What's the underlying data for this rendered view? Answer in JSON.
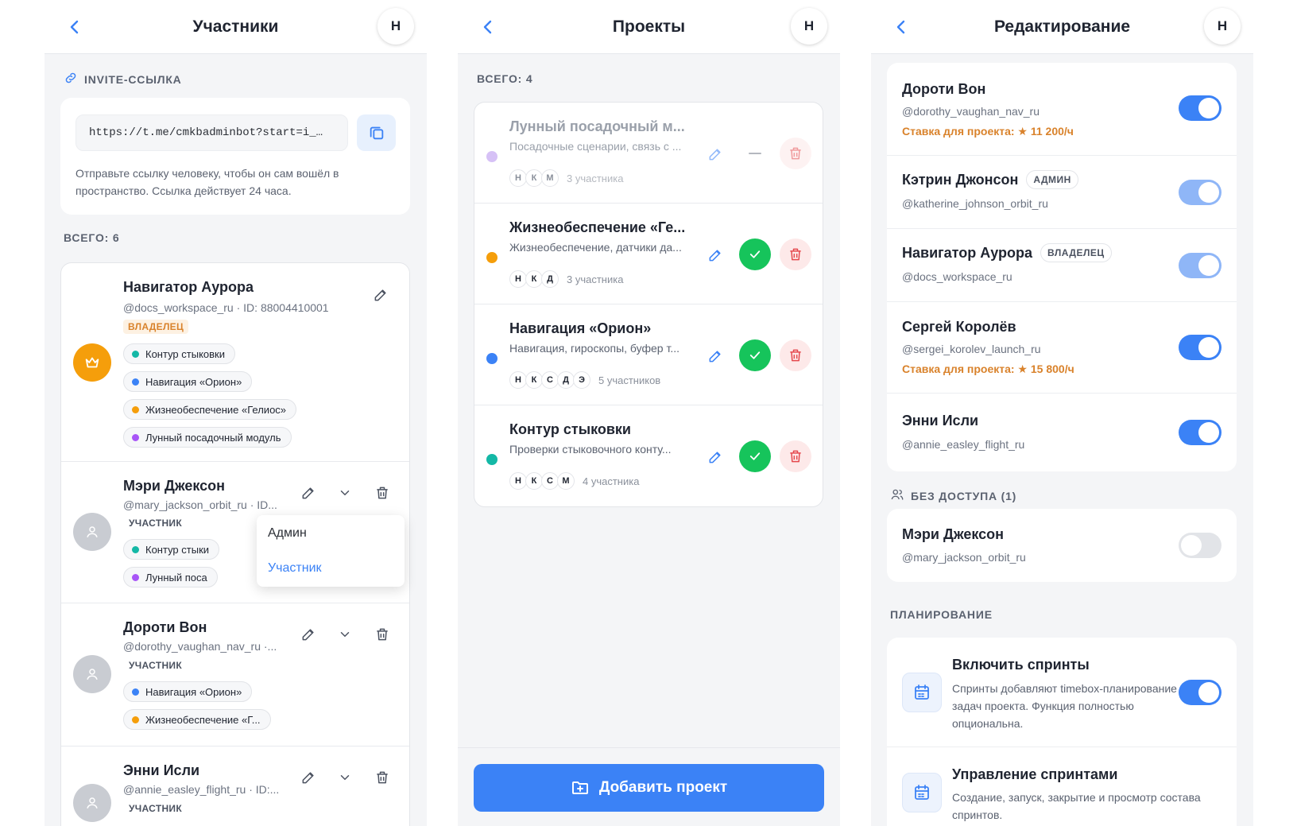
{
  "colors": {
    "accent": "#3b82f6",
    "success": "#16c45b",
    "danger": "#e5484d",
    "warning": "#d9822b",
    "teal": "#14b8a6",
    "blue": "#3b82f6",
    "orange": "#f59e0b",
    "purple": "#a855f7"
  },
  "header_avatar": "Н",
  "participants": {
    "title": "Участники",
    "invite_label": "INVITE-ССЫЛКА",
    "invite_link": "https://t.me/cmkbadminbot?start=i_…",
    "invite_note": "Отправьте ссылку человеку, чтобы он сам вошёл в пространство. Ссылка действует 24 часа.",
    "total": "ВСЕГО: 6",
    "members": [
      {
        "name": "Навигатор Аурора",
        "handle": "@docs_workspace_ru · ID: 88004410001",
        "role": "ВЛАДЕЛЕЦ",
        "chips": [
          "Контур стыковки",
          "Навигация «Орион»",
          "Жизнеобеспечение «Гелиос»",
          "Лунный посадочный модуль"
        ]
      },
      {
        "name": "Мэри Джексон",
        "handle": "@mary_jackson_orbit_ru · ID...",
        "role": "УЧАСТНИК",
        "chips": [
          "Контур стыки",
          "Лунный поса"
        ]
      },
      {
        "name": "Дороти Вон",
        "handle": "@dorothy_vaughan_nav_ru ·...",
        "role": "УЧАСТНИК",
        "chips": [
          "Навигация «Орион»",
          "Жизнеобеспечение «Г..."
        ]
      },
      {
        "name": "Энни Исли",
        "handle": "@annie_easley_flight_ru · ID:...",
        "role": "УЧАСТНИК",
        "chips": []
      }
    ],
    "role_menu": [
      "Админ",
      "Участник"
    ],
    "role_menu_selected": "Участник"
  },
  "projects": {
    "title": "Проекты",
    "total": "ВСЕГО: 4",
    "items": [
      {
        "name": "Лунный посадочный м...",
        "desc": "Посадочные сценарии, связь с ...",
        "avatars": [
          "Н",
          "К",
          "М"
        ],
        "count": "3 участника",
        "color": "#c4a7f2",
        "active": false
      },
      {
        "name": "Жизнеобеспечение «Ге...",
        "desc": "Жизнеобеспечение, датчики да...",
        "avatars": [
          "Н",
          "К",
          "Д"
        ],
        "count": "3 участника",
        "color": "#f59e0b",
        "active": true
      },
      {
        "name": "Навигация «Орион»",
        "desc": "Навигация, гироскопы, буфер т...",
        "avatars": [
          "Н",
          "К",
          "С",
          "Д",
          "Э"
        ],
        "count": "5 участников",
        "color": "#3b82f6",
        "active": true
      },
      {
        "name": "Контур стыковки",
        "desc": "Проверки стыковочного конту...",
        "avatars": [
          "Н",
          "К",
          "С",
          "М"
        ],
        "count": "4 участника",
        "color": "#14b8a6",
        "active": true
      }
    ],
    "add_button": "Добавить проект"
  },
  "editing": {
    "title": "Редактирование",
    "members": [
      {
        "name": "Дороти Вон",
        "handle": "@dorothy_vaughan_nav_ru",
        "badge": "",
        "rate": "Ставка для проекта: ★ 11 200/ч",
        "toggle": "on"
      },
      {
        "name": "Кэтрин Джонсон",
        "handle": "@katherine_johnson_orbit_ru",
        "badge": "АДМИН",
        "rate": "",
        "toggle": "locked"
      },
      {
        "name": "Навигатор Аурора",
        "handle": "@docs_workspace_ru",
        "badge": "ВЛАДЕЛЕЦ",
        "rate": "",
        "toggle": "locked"
      },
      {
        "name": "Сергей Королёв",
        "handle": "@sergei_korolev_launch_ru",
        "badge": "",
        "rate": "Ставка для проекта: ★ 15 800/ч",
        "toggle": "on"
      },
      {
        "name": "Энни Исли",
        "handle": "@annie_easley_flight_ru",
        "badge": "",
        "rate": "",
        "toggle": "on"
      }
    ],
    "no_access_label": "БЕЗ ДОСТУПА (1)",
    "no_access": {
      "name": "Мэри Джексон",
      "handle": "@mary_jackson_orbit_ru",
      "toggle": "off"
    },
    "planning_label": "ПЛАНИРОВАНИЕ",
    "planning": [
      {
        "title": "Включить спринты",
        "desc": "Спринты добавляют timebox-планирование для задач проекта. Функция полностью опциональна.",
        "toggle": "on"
      },
      {
        "title": "Управление спринтами",
        "desc": "Создание, запуск, закрытие и просмотр состава спринтов."
      }
    ]
  }
}
